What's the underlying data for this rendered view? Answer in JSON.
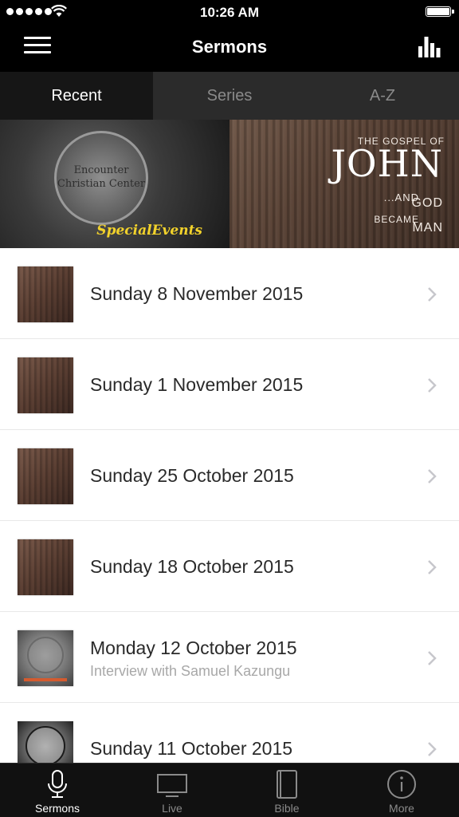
{
  "status_bar": {
    "time": "10:26 AM"
  },
  "nav": {
    "title": "Sermons"
  },
  "tabs": [
    {
      "label": "Recent",
      "active": true
    },
    {
      "label": "Series",
      "active": false
    },
    {
      "label": "A-Z",
      "active": false
    }
  ],
  "banners": {
    "left": {
      "logo_text": "Encounter Christian Center",
      "caption": "SpecialEvents"
    },
    "right": {
      "line1": "THE GOSPEL OF",
      "line2": "JOHN",
      "line3": "...AND",
      "line4": "GOD",
      "line5": "BECAME",
      "line6": "MAN"
    }
  },
  "sermons": [
    {
      "title": "Sunday 8 November 2015",
      "subtitle": "",
      "thumb": "john-series"
    },
    {
      "title": "Sunday 1 November 2015",
      "subtitle": "",
      "thumb": "john-series"
    },
    {
      "title": "Sunday 25 October 2015",
      "subtitle": "",
      "thumb": "john-series"
    },
    {
      "title": "Sunday 18 October 2015",
      "subtitle": "",
      "thumb": "john-series"
    },
    {
      "title": "Monday 12 October 2015",
      "subtitle": "Interview with Samuel Kazungu",
      "thumb": "special-events"
    },
    {
      "title": "Sunday 11 October 2015",
      "subtitle": "",
      "thumb": "encounter-logo"
    }
  ],
  "tab_bar": [
    {
      "label": "Sermons",
      "icon": "microphone-icon",
      "active": true
    },
    {
      "label": "Live",
      "icon": "tv-icon",
      "active": false
    },
    {
      "label": "Bible",
      "icon": "book-icon",
      "active": false
    },
    {
      "label": "More",
      "icon": "info-icon",
      "active": false
    }
  ],
  "colors": {
    "background": "#000000",
    "list_background": "#ffffff",
    "tab_active": "#161616",
    "tab_inactive": "#2b2b2b",
    "accent_yellow": "#f2d22b"
  }
}
